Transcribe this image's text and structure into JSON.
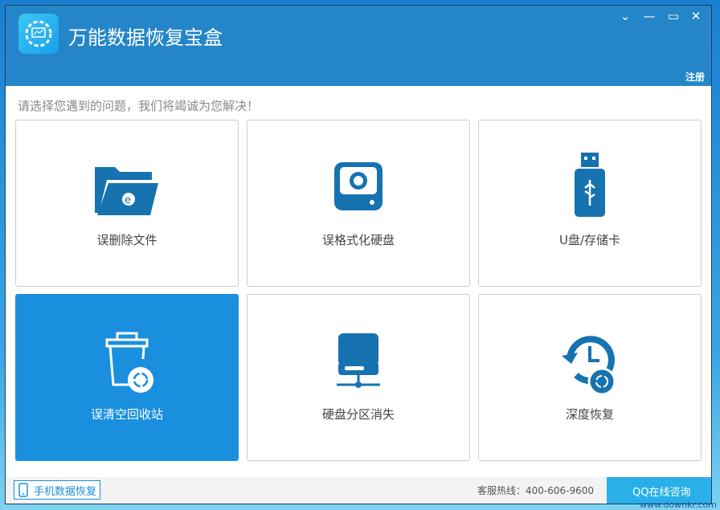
{
  "app": {
    "title": "万能数据恢复宝盒",
    "register": "注册"
  },
  "prompt": "请选择您遇到的问题，我们将竭诚为您解决！",
  "cards": [
    {
      "label": "误删除文件",
      "icon": "folder-restore-icon"
    },
    {
      "label": "误格式化硬盘",
      "icon": "disk-restore-icon"
    },
    {
      "label": "U盘/存储卡",
      "icon": "usb-icon"
    },
    {
      "label": "误清空回收站",
      "icon": "recycle-bin-icon"
    },
    {
      "label": "硬盘分区消失",
      "icon": "network-disk-icon"
    },
    {
      "label": "深度恢复",
      "icon": "history-icon"
    }
  ],
  "footer": {
    "mobile": "手机数据恢复",
    "hotline": "客服热线：400-606-9600",
    "qq": "QQ在线咨询",
    "watermark": "www.downkr.com"
  },
  "colors": {
    "header": "#2486c8",
    "accent": "#1a8fde",
    "icon": "#1673b0"
  }
}
